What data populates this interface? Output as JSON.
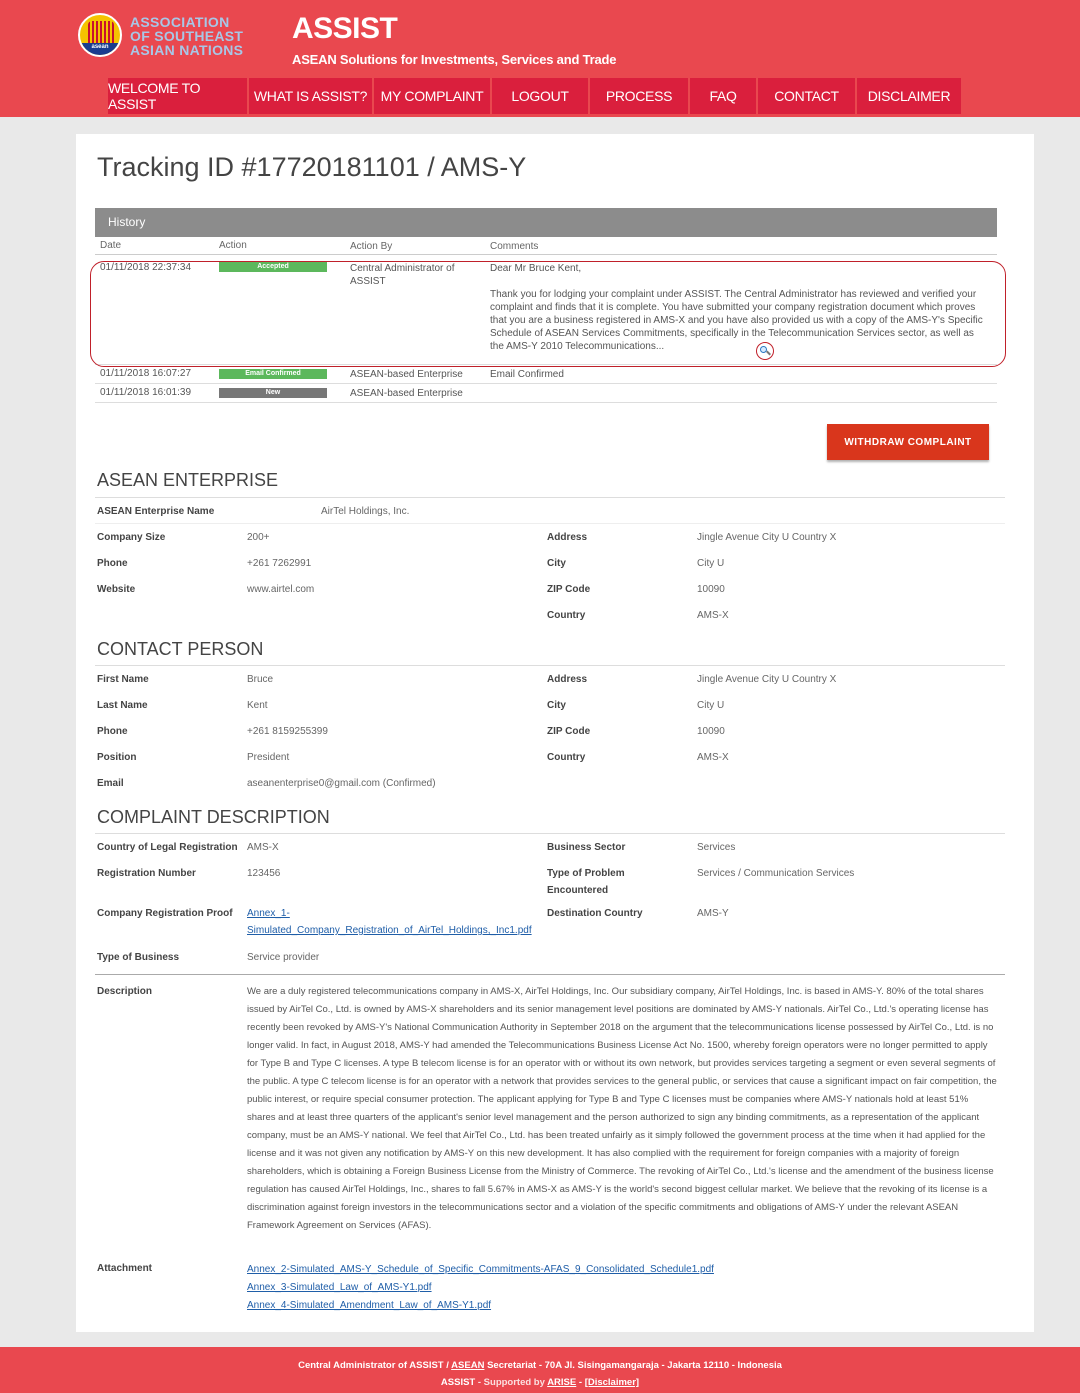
{
  "header": {
    "org_line1": "ASSOCIATION",
    "org_line2": "OF SOUTHEAST",
    "org_line3": "ASIAN NATIONS",
    "logo_text": "asean",
    "title": "ASSIST",
    "subtitle": "ASEAN Solutions for Investments, Services and Trade"
  },
  "nav": {
    "items": [
      {
        "label": "WELCOME TO ASSIST"
      },
      {
        "label": "WHAT IS ASSIST?"
      },
      {
        "label": "MY COMPLAINT"
      },
      {
        "label": "LOGOUT"
      },
      {
        "label": "PROCESS"
      },
      {
        "label": "FAQ"
      },
      {
        "label": "CONTACT"
      },
      {
        "label": "DISCLAIMER"
      }
    ]
  },
  "page": {
    "tracking_title": "Tracking ID #17720181101 / AMS-Y"
  },
  "history": {
    "title": "History",
    "columns": {
      "date": "Date",
      "action": "Action",
      "by": "Action By",
      "comments": "Comments"
    },
    "rows": [
      {
        "date": "01/11/2018 22:37:34",
        "action": "Accepted",
        "by": "Central Administrator of ASSIST",
        "comment_greeting": "Dear Mr Bruce Kent,",
        "comment_body": "Thank you for lodging your complaint under ASSIST. The Central Administrator has reviewed and verified your complaint and finds that it is complete. You have submitted your company registration document which proves that you are a business registered in AMS-X and you have also provided us with a copy of the AMS-Y's Specific Schedule of ASEAN Services Commitments, specifically in the Telecommunication Services sector, as well as the AMS-Y 2010 Telecommunications..."
      },
      {
        "date": "01/11/2018 16:07:27",
        "action": "Email Confirmed",
        "by": "ASEAN-based Enterprise",
        "comment": "Email Confirmed"
      },
      {
        "date": "01/11/2018 16:01:39",
        "action": "New",
        "by": "ASEAN-based Enterprise",
        "comment": ""
      }
    ]
  },
  "withdraw_label": "WITHDRAW COMPLAINT",
  "enterprise": {
    "title": "ASEAN ENTERPRISE",
    "name_label": "ASEAN Enterprise Name",
    "name": "AirTel Holdings, Inc.",
    "size_label": "Company Size",
    "size": "200+",
    "phone_label": "Phone",
    "phone": "+261 7262991",
    "website_label": "Website",
    "website": "www.airtel.com",
    "address_label": "Address",
    "address": "Jingle Avenue City U Country X",
    "city_label": "City",
    "city": "City U",
    "zip_label": "ZIP Code",
    "zip": "10090",
    "country_label": "Country",
    "country": "AMS-X"
  },
  "contact": {
    "title": "CONTACT PERSON",
    "first_label": "First Name",
    "first": "Bruce",
    "last_label": "Last Name",
    "last": "Kent",
    "phone_label": "Phone",
    "phone": "+261 8159255399",
    "position_label": "Position",
    "position": "President",
    "email_label": "Email",
    "email": "aseanenterprise0@gmail.com (Confirmed)",
    "address_label": "Address",
    "address": "Jingle Avenue City U Country X",
    "city_label": "City",
    "city": "City U",
    "zip_label": "ZIP Code",
    "zip": "10090",
    "country_label": "Country",
    "country": "AMS-X"
  },
  "complaint": {
    "title": "COMPLAINT DESCRIPTION",
    "legal_label": "Country of Legal Registration",
    "legal": "AMS-X",
    "regnum_label": "Registration Number",
    "regnum": "123456",
    "proof_label": "Company Registration Proof",
    "proof_line1": "Annex_1-",
    "proof_line2": "Simulated_Company_Registration_of_AirTel_Holdings,_Inc1.pdf",
    "business_type_label": "Type of Business",
    "business_type": "Service provider",
    "sector_label": "Business Sector",
    "sector": "Services",
    "problem_label_line1": "Type of Problem",
    "problem_label_line2": "Encountered",
    "problem": "Services / Communication Services",
    "dest_label": "Destination Country",
    "dest": "AMS-Y",
    "description_label": "Description",
    "description": "We are a duly registered telecommunications company in AMS-X, AirTel Holdings, Inc. Our subsidiary company, AirTel Holdings, Inc. is based in AMS-Y. 80% of the total shares issued by AirTel Co., Ltd. is owned by AMS-X shareholders and its senior management level positions are dominated by AMS-Y nationals. AirTel Co., Ltd.'s operating license has recently been revoked by AMS-Y's National Communication Authority in September 2018 on the argument that the telecommunications license possessed by AirTel Co., Ltd. is no longer valid. In fact, in August 2018, AMS-Y had amended the Telecommunications Business License Act No. 1500, whereby foreign operators were no longer permitted to apply for Type B and Type C licenses. A type B telecom license is for an operator with or without its own network, but provides services targeting a segment or even several segments of the public. A type C telecom license is for an operator with a network that provides services to the general public, or services that cause a significant impact on fair competition, the public interest, or require special consumer protection. The applicant applying for Type B and Type C licenses must be companies where AMS-Y nationals hold at least 51% shares and at least three quarters of the applicant's senior level management and the person authorized to sign any binding commitments, as a representation of the applicant company, must be an AMS-Y national. We feel that AirTel Co., Ltd. has been treated unfairly as it simply followed the government process at the time when it had applied for the license and it was not given any notification by AMS-Y on this new development. It has also complied with the requirement for foreign companies with a majority of foreign shareholders, which is obtaining a Foreign Business License from the Ministry of Commerce. The revoking of AirTel Co., Ltd.'s license and the amendment of the business license regulation has caused AirTel Holdings, Inc., shares to fall 5.67% in AMS-X as AMS-Y is the world's second biggest cellular market. We believe that the revoking of its license is a discrimination against foreign investors in the telecommunications sector and a violation of the specific commitments and obligations of AMS-Y under the relevant ASEAN Framework Agreement on Services (AFAS).",
    "attachment_label": "Attachment",
    "attachments": [
      "Annex_2-Simulated_AMS-Y_Schedule_of_Specific_Commitments-AFAS_9_Consolidated_Schedule1.pdf",
      "Annex_3-Simulated_Law_of_AMS-Y1.pdf",
      "Annex_4-Simulated_Amendment_Law_of_AMS-Y1.pdf"
    ]
  },
  "footer": {
    "l1_prefix": "Central Administrator of ASSIST / ",
    "l1_asean": "ASEAN",
    "l1_suffix": " Secretariat - 70A Jl. Sisingamangaraja - Jakarta 12110 - Indonesia",
    "l2_prefix": "ASSIST",
    "l2_mid": " - Supported by ",
    "l2_arise": "ARISE",
    "l2_dash": " - ",
    "l2_disclaimer": "[Disclaimer]"
  },
  "colors": {
    "header_bg": "#e9484f",
    "nav_bg": "#da1f3d",
    "accepted": "#5cb85c",
    "new": "#777777",
    "withdraw": "#d9361c",
    "link": "#1f5ea8",
    "highlight": "#c0202a"
  }
}
